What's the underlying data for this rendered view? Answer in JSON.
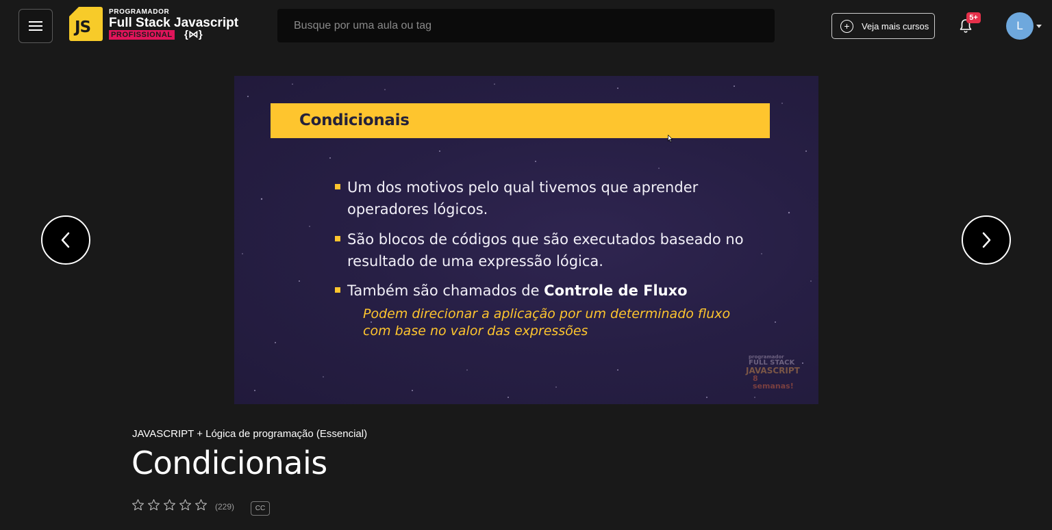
{
  "header": {
    "logo": {
      "js_mark": "JS",
      "small_text": "PROGRAMADOR",
      "main_text": "Full Stack Javascript",
      "badge_text": "PROFISSIONAL",
      "braces_text": "{⋈}"
    },
    "search": {
      "placeholder": "Busque por uma aula ou tag",
      "value": ""
    },
    "more_courses_label": "Veja mais cursos",
    "notifications_badge": "5+",
    "avatar_initial": "L"
  },
  "video": {
    "slide_title": "Condicionais",
    "bullets": [
      {
        "text": "Um dos motivos pelo qual tivemos que aprender operadores lógicos."
      },
      {
        "text": "São blocos de códigos que são executados baseado no resultado de uma expressão lógica."
      },
      {
        "text_prefix": "Também são chamados de ",
        "text_bold": "Controle de Fluxo"
      }
    ],
    "note": "Podem direcionar a aplicação por um determinado fluxo com base no valor das expressões",
    "watermark": {
      "line1": "programador",
      "line2": "FULL STACK",
      "line3": "JAVASCRIPT",
      "line4": "8 semanas!"
    }
  },
  "lesson": {
    "course_name": "JAVASCRIPT + Lógica de programação (Essencial)",
    "title": "Condicionais",
    "rating_stars_filled": 0,
    "rating_stars_total": 5,
    "rating_count": "(229)",
    "cc_label": "CC"
  },
  "colors": {
    "background": "#191919",
    "slide_background": "#271f45",
    "slide_accent": "#fec52e",
    "notification_badge": "#e5304a",
    "avatar": "#6ea8dd",
    "logo_yellow": "#f7cb29",
    "logo_pink": "#e0145a"
  },
  "icons": {
    "menu": "hamburger-icon",
    "more_courses": "plus-circle-icon",
    "notifications": "bell-icon",
    "prev": "chevron-left-icon",
    "next": "chevron-right-icon",
    "rating": "star-outline-icon"
  }
}
